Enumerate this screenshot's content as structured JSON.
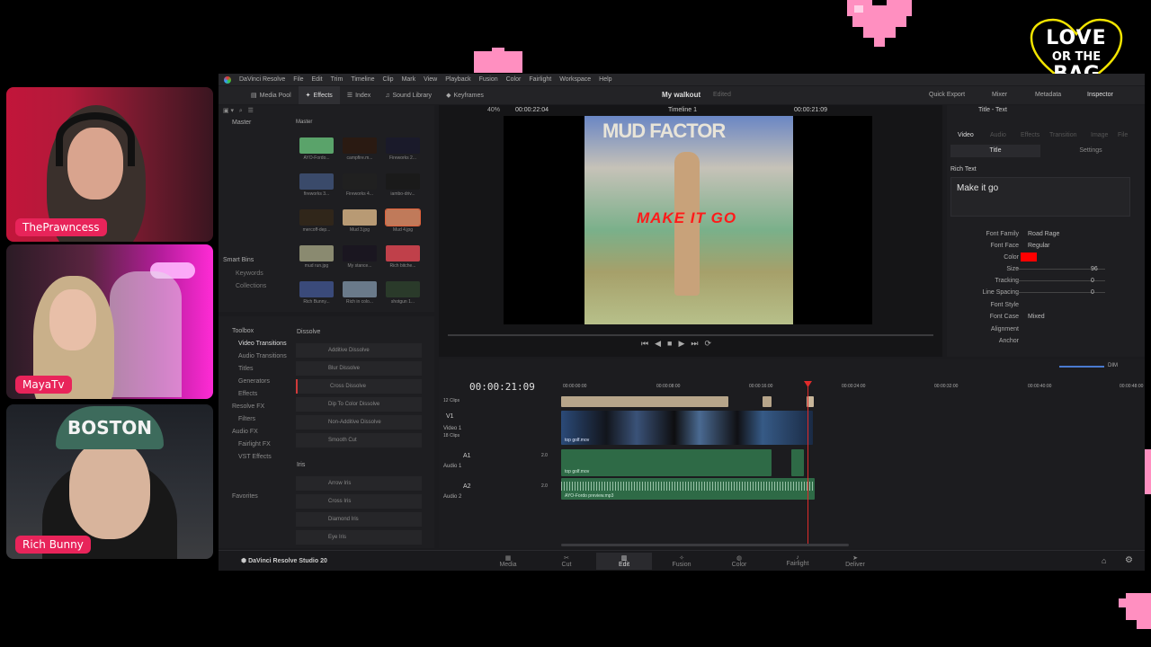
{
  "overlay": {
    "logo_line1": "LOVE",
    "logo_line2": "OR THE",
    "logo_line3": "BAG"
  },
  "webcams": [
    {
      "name": "ThePrawncess"
    },
    {
      "name": "MayaTv"
    },
    {
      "name": "Rich Bunny",
      "cap_text": "BOSTON"
    }
  ],
  "app": {
    "menu": [
      "DaVinci Resolve",
      "File",
      "Edit",
      "Trim",
      "Timeline",
      "Clip",
      "Mark",
      "View",
      "Playback",
      "Fusion",
      "Color",
      "Fairlight",
      "Workspace",
      "Help"
    ],
    "toolbar_left": [
      "Media Pool",
      "Effects",
      "Index",
      "Sound Library",
      "Keyframes"
    ],
    "project_title": "My walkout",
    "project_status": "Edited",
    "toolbar_right": [
      "Quick Export",
      "Mixer",
      "Metadata",
      "Inspector"
    ],
    "brand": "DaVinci Resolve Studio 20"
  },
  "media_pool": {
    "header": "Master",
    "bin": "Master",
    "clips": [
      "AYO-Fordo...",
      "campfire.m...",
      "Fireworks 2...",
      "fireworks 3...",
      "Fireworks 4...",
      "iambo-driv...",
      "mercoff-dep...",
      "Mud 3.jpg",
      "Mud 4.jpg",
      "mud run.jpg",
      "My stance...",
      "Rich bitche...",
      "Rich Bunny...",
      "Rich in colo...",
      "shotgun 1..."
    ],
    "smart_bins": "Smart Bins",
    "keywords": "Keywords",
    "collections": "Collections"
  },
  "effects": {
    "toolbox": "Toolbox",
    "tree": [
      "Video Transitions",
      "Audio Transitions",
      "Titles",
      "Generators",
      "Effects",
      "Resolve FX",
      "Filters",
      "Audio FX",
      "Fairlight FX",
      "VST Effects",
      "Favorites"
    ],
    "section1": "Dissolve",
    "dissolve_items": [
      "Additive Dissolve",
      "Blur Dissolve",
      "Cross Dissolve",
      "Dip To Color Dissolve",
      "Non-Additive Dissolve",
      "Smooth Cut"
    ],
    "section2": "Iris",
    "iris_items": [
      "Arrow Iris",
      "Cross Iris",
      "Diamond Iris",
      "Eye Iris"
    ]
  },
  "viewer": {
    "zoom": "40%",
    "source_tc": "00:00:22:04",
    "timeline_name": "Timeline 1",
    "record_tc": "00:00:21:09",
    "sign_text": "MUD FACTOR",
    "overlay_text": "MAKE IT GO"
  },
  "timeline": {
    "timecode": "00:00:21:09",
    "ruler": [
      "00:00:00:00",
      "00:00:08:00",
      "00:00:16:00",
      "00:00:24:00",
      "00:00:32:00",
      "00:00:40:00",
      "00:00:48:00"
    ],
    "clips_count": "12 Clips",
    "v1_name": "Video 1",
    "v1_clips": "18 Clips",
    "a1_name": "Audio 1",
    "a2_name": "Audio 2",
    "a1_level": "2.0",
    "a2_level": "2.0",
    "clip_label": "top golf.mov",
    "audio2_clip": "AYO-Fordo preview.mp3",
    "track_v": "V1",
    "track_a1": "A1",
    "track_a2": "A2",
    "dim": "DIM"
  },
  "inspector": {
    "title": "Title - Text",
    "tabs": [
      "Video",
      "Audio",
      "Effects",
      "Transition",
      "Image",
      "File"
    ],
    "subtabs": [
      "Title",
      "Settings"
    ],
    "rich_text_label": "Rich Text",
    "rich_text_value": "Make it go",
    "font_family_label": "Font Family",
    "font_family": "Road Rage",
    "font_face_label": "Font Face",
    "font_face": "Regular",
    "color_label": "Color",
    "color_hex": "#ff0000",
    "size_label": "Size",
    "size": "96",
    "tracking_label": "Tracking",
    "tracking": "0",
    "line_spacing_label": "Line Spacing",
    "line_spacing": "0",
    "font_style_label": "Font Style",
    "font_case_label": "Font Case",
    "font_case": "Mixed",
    "alignment_label": "Alignment",
    "anchor_label": "Anchor"
  },
  "bottom_nav": [
    "Media",
    "Cut",
    "Edit",
    "Fusion",
    "Color",
    "Fairlight",
    "Deliver"
  ]
}
